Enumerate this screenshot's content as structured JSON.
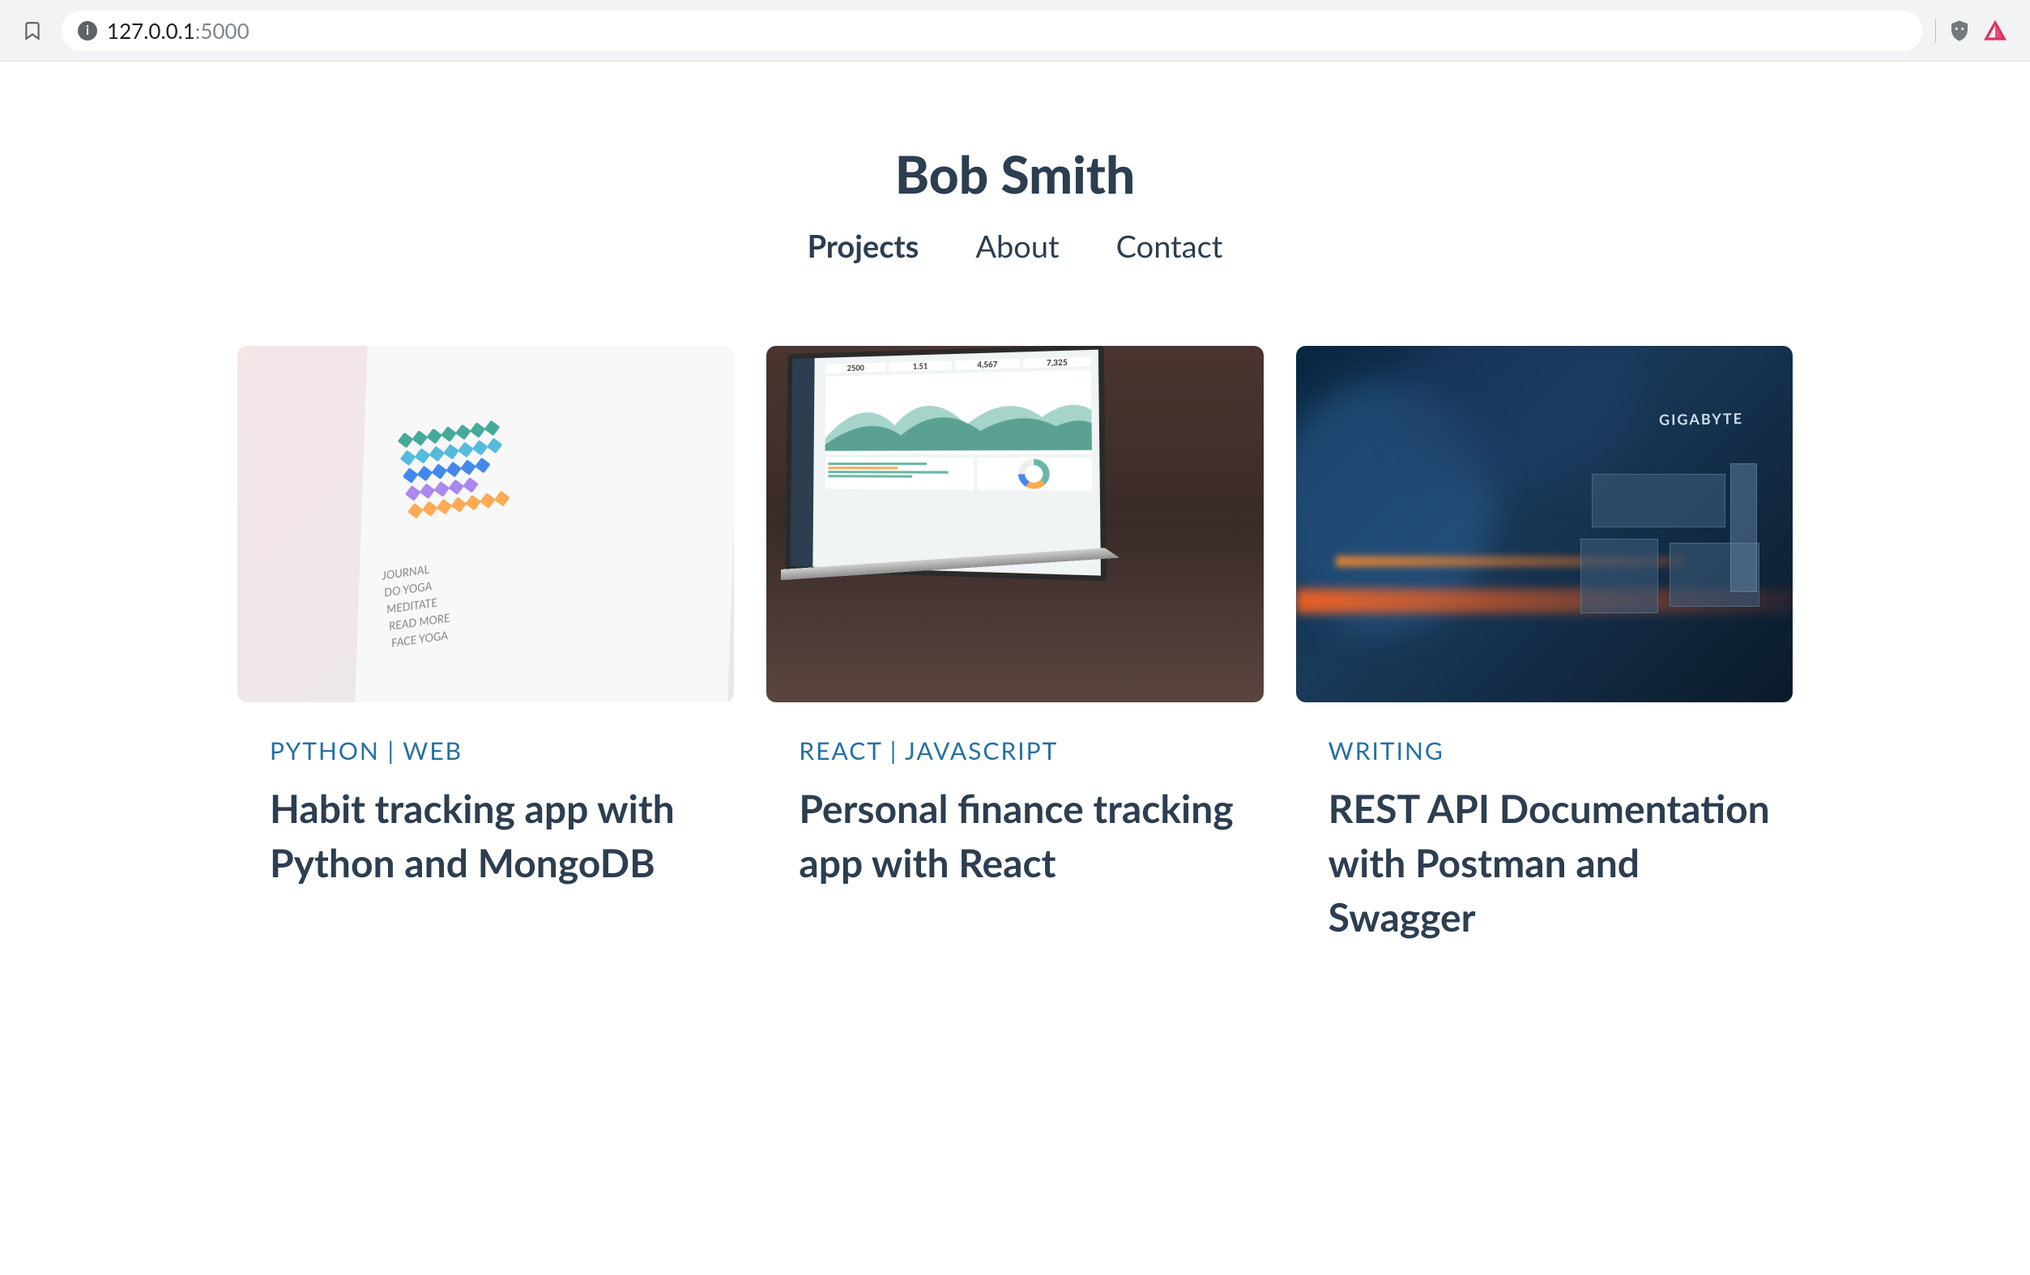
{
  "browser": {
    "url_host": "127.0.0.1",
    "url_port": ":5000"
  },
  "header": {
    "title": "Bob Smith"
  },
  "nav": {
    "items": [
      {
        "label": "Projects",
        "active": true
      },
      {
        "label": "About",
        "active": false
      },
      {
        "label": "Contact",
        "active": false
      }
    ]
  },
  "cards": [
    {
      "category": "PYTHON | WEB",
      "title": "Habit tracking app with Python and MongoDB",
      "image_alt": "planner-notebook"
    },
    {
      "category": "REACT | JAVASCRIPT",
      "title": "Personal finance tracking app with React",
      "image_alt": "laptop-dashboard"
    },
    {
      "category": "WRITING",
      "title": "REST API Documentation with Postman and Swagger",
      "image_alt": "motherboard-hardware"
    }
  ],
  "planner": {
    "labels": [
      "JOURNAL",
      "DO YOGA",
      "MEDITATE",
      "READ MORE",
      "FACE YOGA"
    ]
  },
  "dashboard": {
    "stats": [
      "2500",
      "1.51",
      "4,567",
      "7,325"
    ],
    "brand": "GIGABYTE"
  },
  "colors": {
    "accent": "#2471a3",
    "heading": "#2c3e50"
  }
}
